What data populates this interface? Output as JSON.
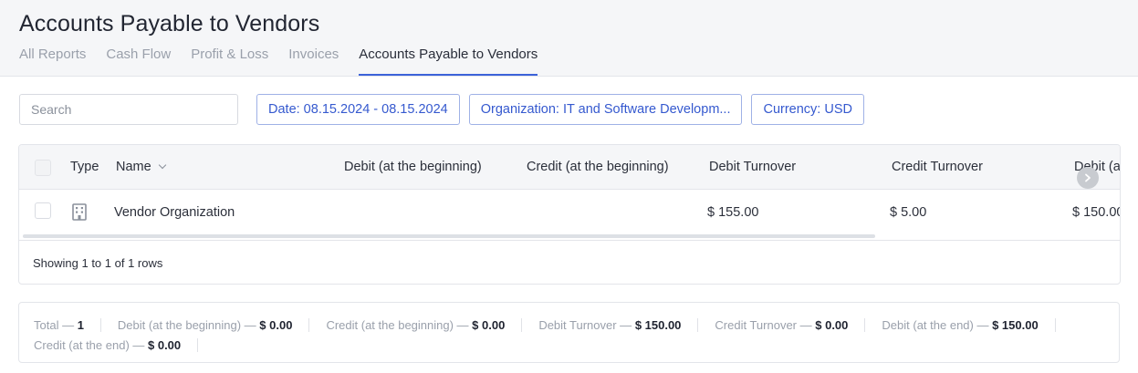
{
  "page": {
    "title": "Accounts Payable to Vendors"
  },
  "tabs": [
    {
      "label": "All Reports"
    },
    {
      "label": "Cash Flow"
    },
    {
      "label": "Profit & Loss"
    },
    {
      "label": "Invoices"
    },
    {
      "label": "Accounts Payable to Vendors",
      "active": true
    }
  ],
  "filters": {
    "search_placeholder": "Search",
    "date": "Date: 08.15.2024 - 08.15.2024",
    "organization": "Organization: IT and Software Developm...",
    "currency": "Currency: USD"
  },
  "table": {
    "columns": [
      "Type",
      "Name",
      "Debit (at the beginning)",
      "Credit (at the beginning)",
      "Debit Turnover",
      "Credit Turnover",
      "Debit (a"
    ],
    "rows": [
      {
        "type_icon": "building-icon",
        "name": "Vendor Organization",
        "debit_begin": "",
        "credit_begin": "",
        "debit_turnover": "$ 155.00",
        "credit_turnover": "$ 5.00",
        "debit_end": "$ 150.00"
      }
    ],
    "showing": "Showing 1 to 1 of 1 rows"
  },
  "totals": [
    {
      "label": "Total — ",
      "value": "1"
    },
    {
      "label": "Debit (at the beginning) — ",
      "value": "$ 0.00"
    },
    {
      "label": "Credit (at the beginning) — ",
      "value": "$ 0.00"
    },
    {
      "label": "Debit Turnover — ",
      "value": "$ 150.00"
    },
    {
      "label": "Credit Turnover — ",
      "value": "$ 0.00"
    },
    {
      "label": "Debit (at the end) — ",
      "value": "$ 150.00"
    },
    {
      "label": "Credit (at the end) — ",
      "value": "$ 0.00"
    }
  ],
  "colors": {
    "accent": "#3559cf",
    "tab_underline": "#3c63d9",
    "header_bg": "#f5f6f8"
  }
}
